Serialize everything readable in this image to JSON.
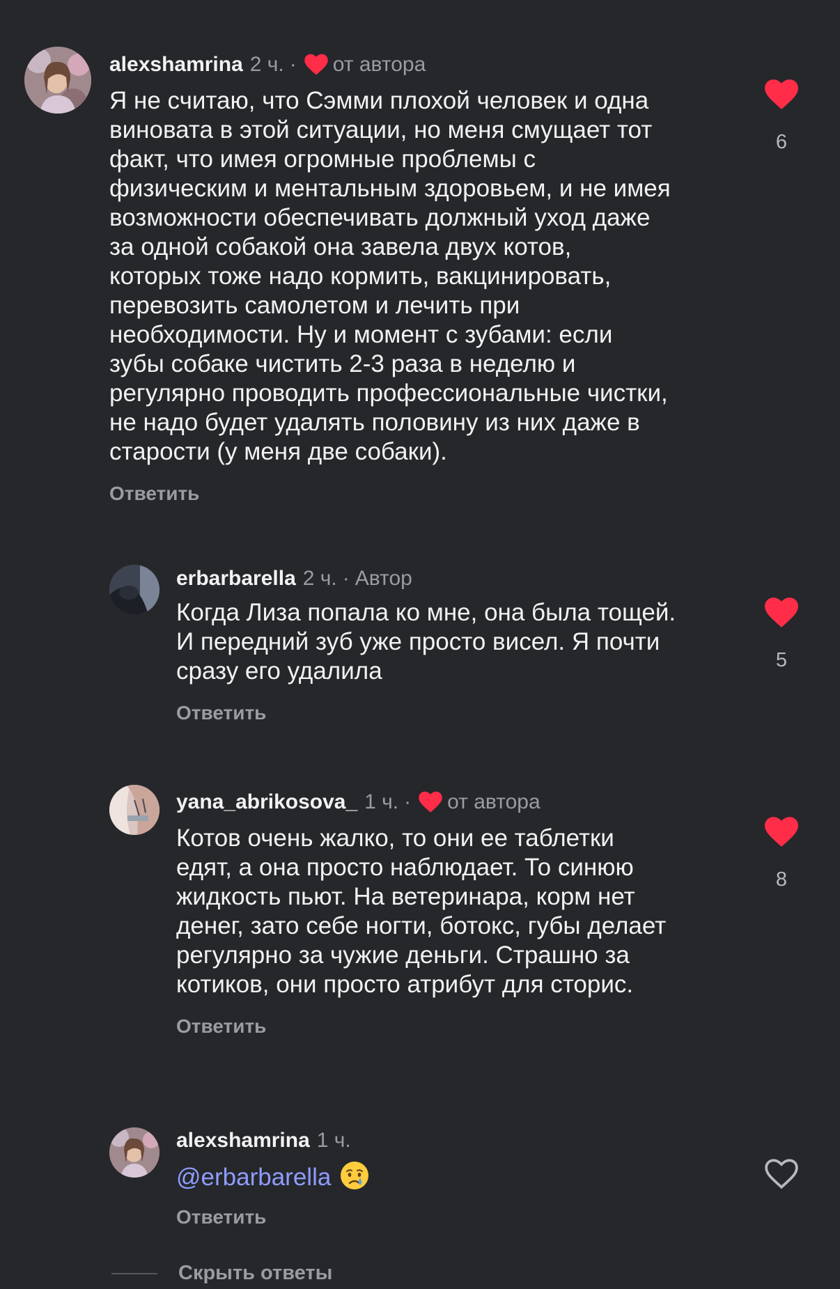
{
  "comments": [
    {
      "username": "alexshamrina",
      "time": "2 ч.",
      "separator": "·",
      "author_like_label": "от автора",
      "lines": [
        "Я не считаю, что Сэмми плохой человек и одна",
        "виновата в этой ситуации, но меня смущает тот",
        "факт, что имея огромные проблемы с",
        "физическим и ментальным здоровьем, и не имея",
        "возможности обеспечивать должный уход даже",
        "за одной собакой она завела двух котов,",
        "которых тоже надо кормить, вакцинировать,",
        "перевозить самолетом и лечить при",
        "необходимости. Ну и момент с зубами: если",
        "зубы собаке чистить 2-3 раза в неделю и",
        "регулярно проводить профессиональные чистки,",
        "не надо будет удалять половину из них даже в",
        "старости (у меня две собаки)."
      ],
      "reply_label": "Ответить",
      "likes": "6",
      "liked": true
    },
    {
      "username": "erbarbarella",
      "time": "2 ч.",
      "separator": "·",
      "author_badge": "Автор",
      "lines": [
        "Когда Лиза попала ко мне, она была тощей.",
        "И передний зуб уже просто висел. Я почти",
        "сразу его удалила"
      ],
      "reply_label": "Ответить",
      "likes": "5",
      "liked": true
    },
    {
      "username": "yana_abrikosova_",
      "time": "1 ч.",
      "separator": "·",
      "author_like_label": "от автора",
      "lines": [
        "Котов очень жалко, то они ее таблетки",
        "едят, а она просто наблюдает. То синюю",
        "жидкость пьют. На ветеринара, корм нет",
        "денег, зато себе ногти, ботокс, губы делает",
        "регулярно за чужие деньги. Страшно за",
        "котиков, они просто атрибут для сторис."
      ],
      "reply_label": "Ответить",
      "likes": "8",
      "liked": true
    },
    {
      "username": "alexshamrina",
      "time": "1 ч.",
      "mention": "@erbarbarella",
      "emoji": "crying-face",
      "reply_label": "Ответить",
      "liked": false
    }
  ],
  "hide_replies_label": "Скрыть ответы",
  "colors": {
    "background": "#25272b",
    "like_red": "#ff2d48",
    "mention": "#8f9cff",
    "muted": "#9a9ca1"
  },
  "icons": [
    "avatar",
    "heart-filled-icon",
    "heart-outline-icon",
    "crying-face-emoji"
  ]
}
